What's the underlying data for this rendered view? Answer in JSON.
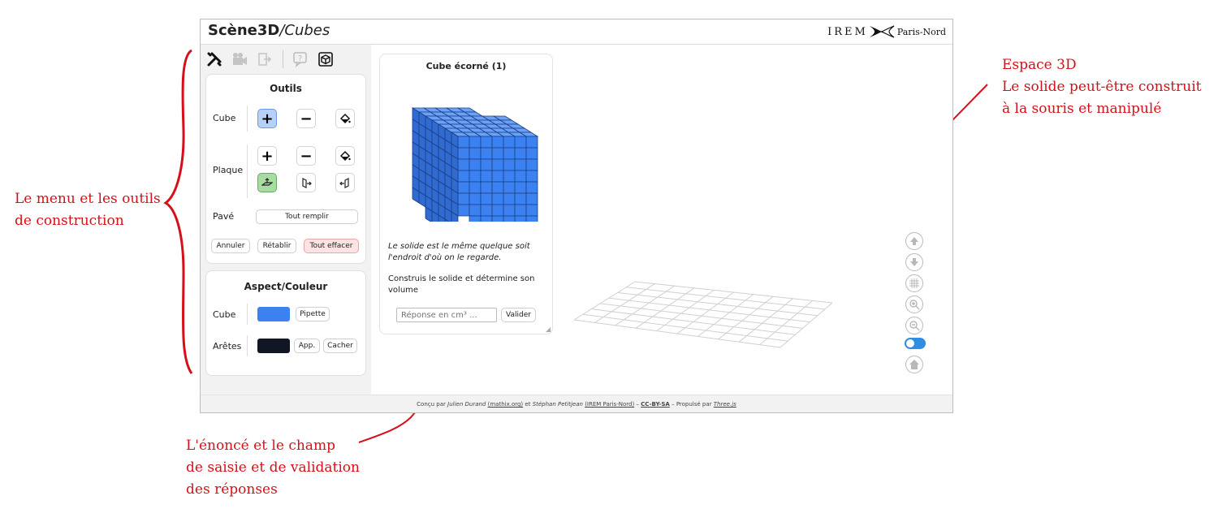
{
  "annotations": {
    "left_line1": "Le menu et les outils",
    "left_line2": "de construction",
    "right_line1": "Espace 3D",
    "right_line2": "Le solide peut-être construit",
    "right_line3": "à la souris et manipulé",
    "bottom_line1": "L'énoncé et le champ",
    "bottom_line2": "de saisie et de validation",
    "bottom_line3": "des réponses",
    "color": "#d6101a"
  },
  "header": {
    "title": "Scène3D",
    "subtitle": "/Cubes",
    "brand_irem": "IREM",
    "brand_paris": "Paris-Nord"
  },
  "toolbar": {
    "icons": [
      "tools-icon",
      "camera-icon",
      "exit-icon",
      "help-icon",
      "cube-view-icon"
    ]
  },
  "tools": {
    "title": "Outils",
    "cube_label": "Cube",
    "plaque_label": "Plaque",
    "pave_label": "Pavé",
    "fill_all": "Tout remplir",
    "undo": "Annuler",
    "redo": "Rétablir",
    "clear_all": "Tout effacer"
  },
  "aspect": {
    "title": "Aspect/Couleur",
    "cube_label": "Cube",
    "cube_color": "#3b82f0",
    "pipette": "Pipette",
    "edges_label": "Arêtes",
    "edges_color": "#101624",
    "app": "App.",
    "hide": "Cacher"
  },
  "task": {
    "title": "Cube écorné (1)",
    "note": "Le solide est le même quelque soit l'endroit d'où on le regarde.",
    "instruction": "Construis le solide et détermine son volume",
    "input_placeholder": "Réponse en cm³ ...",
    "validate": "Valider",
    "cube_color": "#3b82f0"
  },
  "viewport_controls": [
    "arrow-up-icon",
    "arrow-down-icon",
    "grid-icon",
    "zoom-in-icon",
    "zoom-out-icon",
    "toggle-switch",
    "home-icon"
  ],
  "footer": {
    "designed_by": "Conçu par",
    "author1": "Julien Durand",
    "author1_site": "(mathix.org)",
    "and": "et",
    "author2": "Stéphan Petitjean",
    "author2_site": "(IREM Paris-Nord)",
    "license": "CC-BY-SA",
    "powered_by": "– Propulsé par",
    "engine": "Three.js"
  }
}
